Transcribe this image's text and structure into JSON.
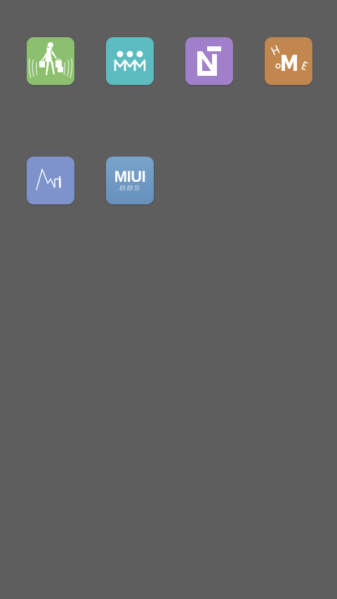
{
  "screen": {
    "background": "#5e5e5e"
  },
  "apps": [
    {
      "id": "shopping",
      "icon": "shopping-woman-icon",
      "color": "#8cc06e"
    },
    {
      "id": "mmm",
      "icon": "mmm-people-icon",
      "color": "#5dbcc0"
    },
    {
      "id": "notes",
      "icon": "n-logo-icon",
      "color": "#a07fcb"
    },
    {
      "id": "home",
      "icon": "home-letters-icon",
      "color": "#c2864f"
    },
    {
      "id": "monitor",
      "icon": "waveform-icon",
      "color": "#7e93cc"
    },
    {
      "id": "miuibbs",
      "icon": "miui-bbs-icon",
      "color": "#6f9ac4",
      "text": "MIUI",
      "subtext": "BBS"
    }
  ]
}
